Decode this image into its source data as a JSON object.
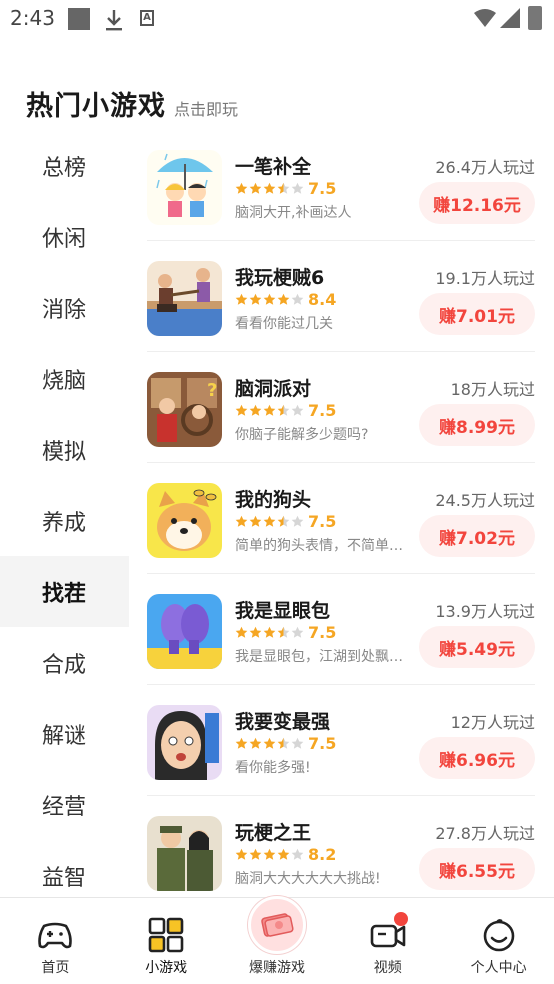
{
  "status_bar": {
    "time": "2:43"
  },
  "header": {
    "title": "热门小游戏",
    "subtitle": "点击即玩"
  },
  "sidebar": {
    "items": [
      {
        "label": "总榜",
        "active": false
      },
      {
        "label": "休闲",
        "active": false
      },
      {
        "label": "消除",
        "active": false
      },
      {
        "label": "烧脑",
        "active": false
      },
      {
        "label": "模拟",
        "active": false
      },
      {
        "label": "养成",
        "active": false
      },
      {
        "label": "找茬",
        "active": true
      },
      {
        "label": "合成",
        "active": false
      },
      {
        "label": "解谜",
        "active": false
      },
      {
        "label": "经营",
        "active": false
      },
      {
        "label": "益智",
        "active": false
      }
    ]
  },
  "games": [
    {
      "name": "一笔补全",
      "rating": "7.5",
      "stars": 3.5,
      "desc": "脑洞大开,补画达人",
      "players": "26.4万人玩过",
      "earn": "赚12.16元",
      "icon": "rain-umbrella-kids-icon"
    },
    {
      "name": "我玩梗贼6",
      "rating": "8.4",
      "stars": 4,
      "desc": "看看你能过几关",
      "players": "19.1万人玩过",
      "earn": "赚7.01元",
      "icon": "tug-of-war-icon"
    },
    {
      "name": "脑洞派对",
      "rating": "7.5",
      "stars": 3.5,
      "desc": "你脑子能解多少题吗?",
      "players": "18万人玩过",
      "earn": "赚8.99元",
      "icon": "party-room-icon"
    },
    {
      "name": "我的狗头",
      "rating": "7.5",
      "stars": 3.5,
      "desc": "简单的狗头表情，不简单的挑战",
      "players": "24.5万人玩过",
      "earn": "赚7.02元",
      "icon": "dog-head-icon"
    },
    {
      "name": "我是显眼包",
      "rating": "7.5",
      "stars": 3.5,
      "desc": "我是显眼包，江湖到处飘来飘去",
      "players": "13.9万人玩过",
      "earn": "赚5.49元",
      "icon": "purple-character-icon"
    },
    {
      "name": "我要变最强",
      "rating": "7.5",
      "stars": 3.5,
      "desc": "看你能多强!",
      "players": "12万人玩过",
      "earn": "赚6.96元",
      "icon": "shocked-woman-icon"
    },
    {
      "name": "玩梗之王",
      "rating": "8.2",
      "stars": 4,
      "desc": "脑洞大大大大大大挑战!",
      "players": "27.8万人玩过",
      "earn": "赚6.55元",
      "icon": "uniform-couple-icon"
    }
  ],
  "bottom_nav": {
    "items": [
      {
        "label": "首页",
        "icon": "gamepad-icon"
      },
      {
        "label": "小游戏",
        "icon": "grid-icon"
      },
      {
        "label": "爆赚游戏",
        "icon": "money-icon"
      },
      {
        "label": "视频",
        "icon": "video-camera-icon"
      },
      {
        "label": "个人中心",
        "icon": "smiley-face-icon"
      }
    ]
  },
  "colors": {
    "accent_red": "#f2453d",
    "star": "#f5a623",
    "earn_bg": "#fef0ef"
  }
}
